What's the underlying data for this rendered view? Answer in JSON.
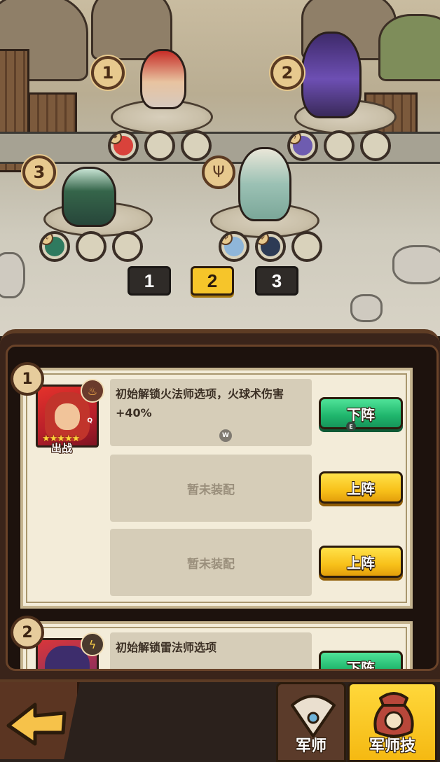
{
  "battlefield": {
    "positions": [
      {
        "num": "1",
        "slots": 3
      },
      {
        "num": "2",
        "slots": 3
      },
      {
        "num": "3",
        "slots": 3
      }
    ],
    "team_tabs": [
      "1",
      "2",
      "3"
    ],
    "active_team_tab": "2"
  },
  "panel": {
    "cards": [
      {
        "num": "1",
        "hero_status": "出战",
        "hero_stars": "★★★★★",
        "hero_hotkey": "Q",
        "element_icon": "fire-icon",
        "slots": [
          {
            "text": "初始解锁火法师选项，火球术伤害+40%",
            "hotkey": "W",
            "button": "下阵",
            "button_hotkey": "E"
          },
          {
            "text": "暂未装配",
            "button": "上阵"
          },
          {
            "text": "暂未装配",
            "button": "上阵"
          }
        ]
      },
      {
        "num": "2",
        "element_icon": "lightning-icon",
        "slots": [
          {
            "text": "初始解锁雷法师选项",
            "button": "下阵"
          }
        ]
      }
    ]
  },
  "bottom_nav": {
    "tabs": [
      {
        "label": "军师",
        "icon": "feather-fan-icon"
      },
      {
        "label": "军师技",
        "icon": "brocade-bag-icon"
      }
    ],
    "active": "军师技"
  },
  "colors": {
    "accent_yellow": "#f8c11a",
    "accent_green": "#1fb56c",
    "panel_bg": "#3a241a",
    "card_bg": "#f3ecd9"
  }
}
